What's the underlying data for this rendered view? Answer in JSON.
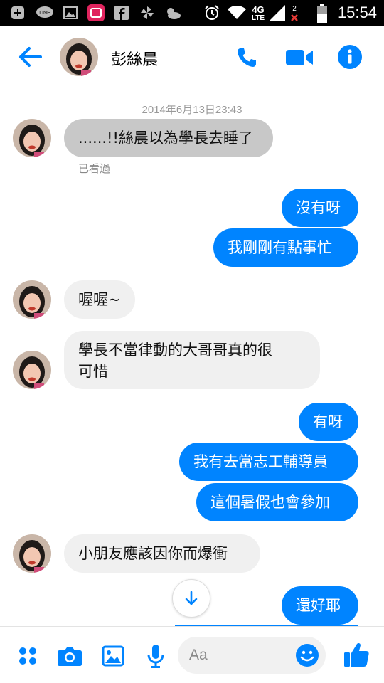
{
  "status_bar": {
    "time": "15:54",
    "network": "4G",
    "network_sub": "LTE",
    "sim_slot": "2",
    "icons": [
      "add-icon",
      "line-app-icon",
      "image-icon",
      "app-icon",
      "facebook-icon",
      "pinwheel-icon",
      "weather-icon",
      "alarm-icon",
      "wifi-icon",
      "signal-icon",
      "battery-icon"
    ]
  },
  "header": {
    "contact_name": "彭絲晨",
    "icons": [
      "back-arrow-icon",
      "phone-icon",
      "video-icon",
      "info-icon"
    ],
    "accent": "#0084ff"
  },
  "conversation": {
    "timestamp": "2014年6月13日23:43",
    "seen_label": "已看過",
    "messages": [
      {
        "from": "them",
        "text": "......!!絲晨以為學長去睡了"
      },
      {
        "from": "me",
        "text": "沒有呀"
      },
      {
        "from": "me",
        "text": "我剛剛有點事忙"
      },
      {
        "from": "them",
        "text": "喔喔~"
      },
      {
        "from": "them",
        "line1": "學長不當律動的大哥哥真的很",
        "line2": "可惜"
      },
      {
        "from": "me",
        "text": "有呀"
      },
      {
        "from": "me",
        "text": "我有去當志工輔導員"
      },
      {
        "from": "me",
        "text": "這個暑假也會參加"
      },
      {
        "from": "them",
        "text": "小朋友應該因你而爆衝"
      },
      {
        "from": "me",
        "text": "還好耶"
      }
    ]
  },
  "composer": {
    "placeholder": "Aa",
    "icons": [
      "more-apps-icon",
      "camera-icon",
      "gallery-icon",
      "microphone-icon",
      "emoji-icon",
      "thumbs-up-icon"
    ]
  }
}
